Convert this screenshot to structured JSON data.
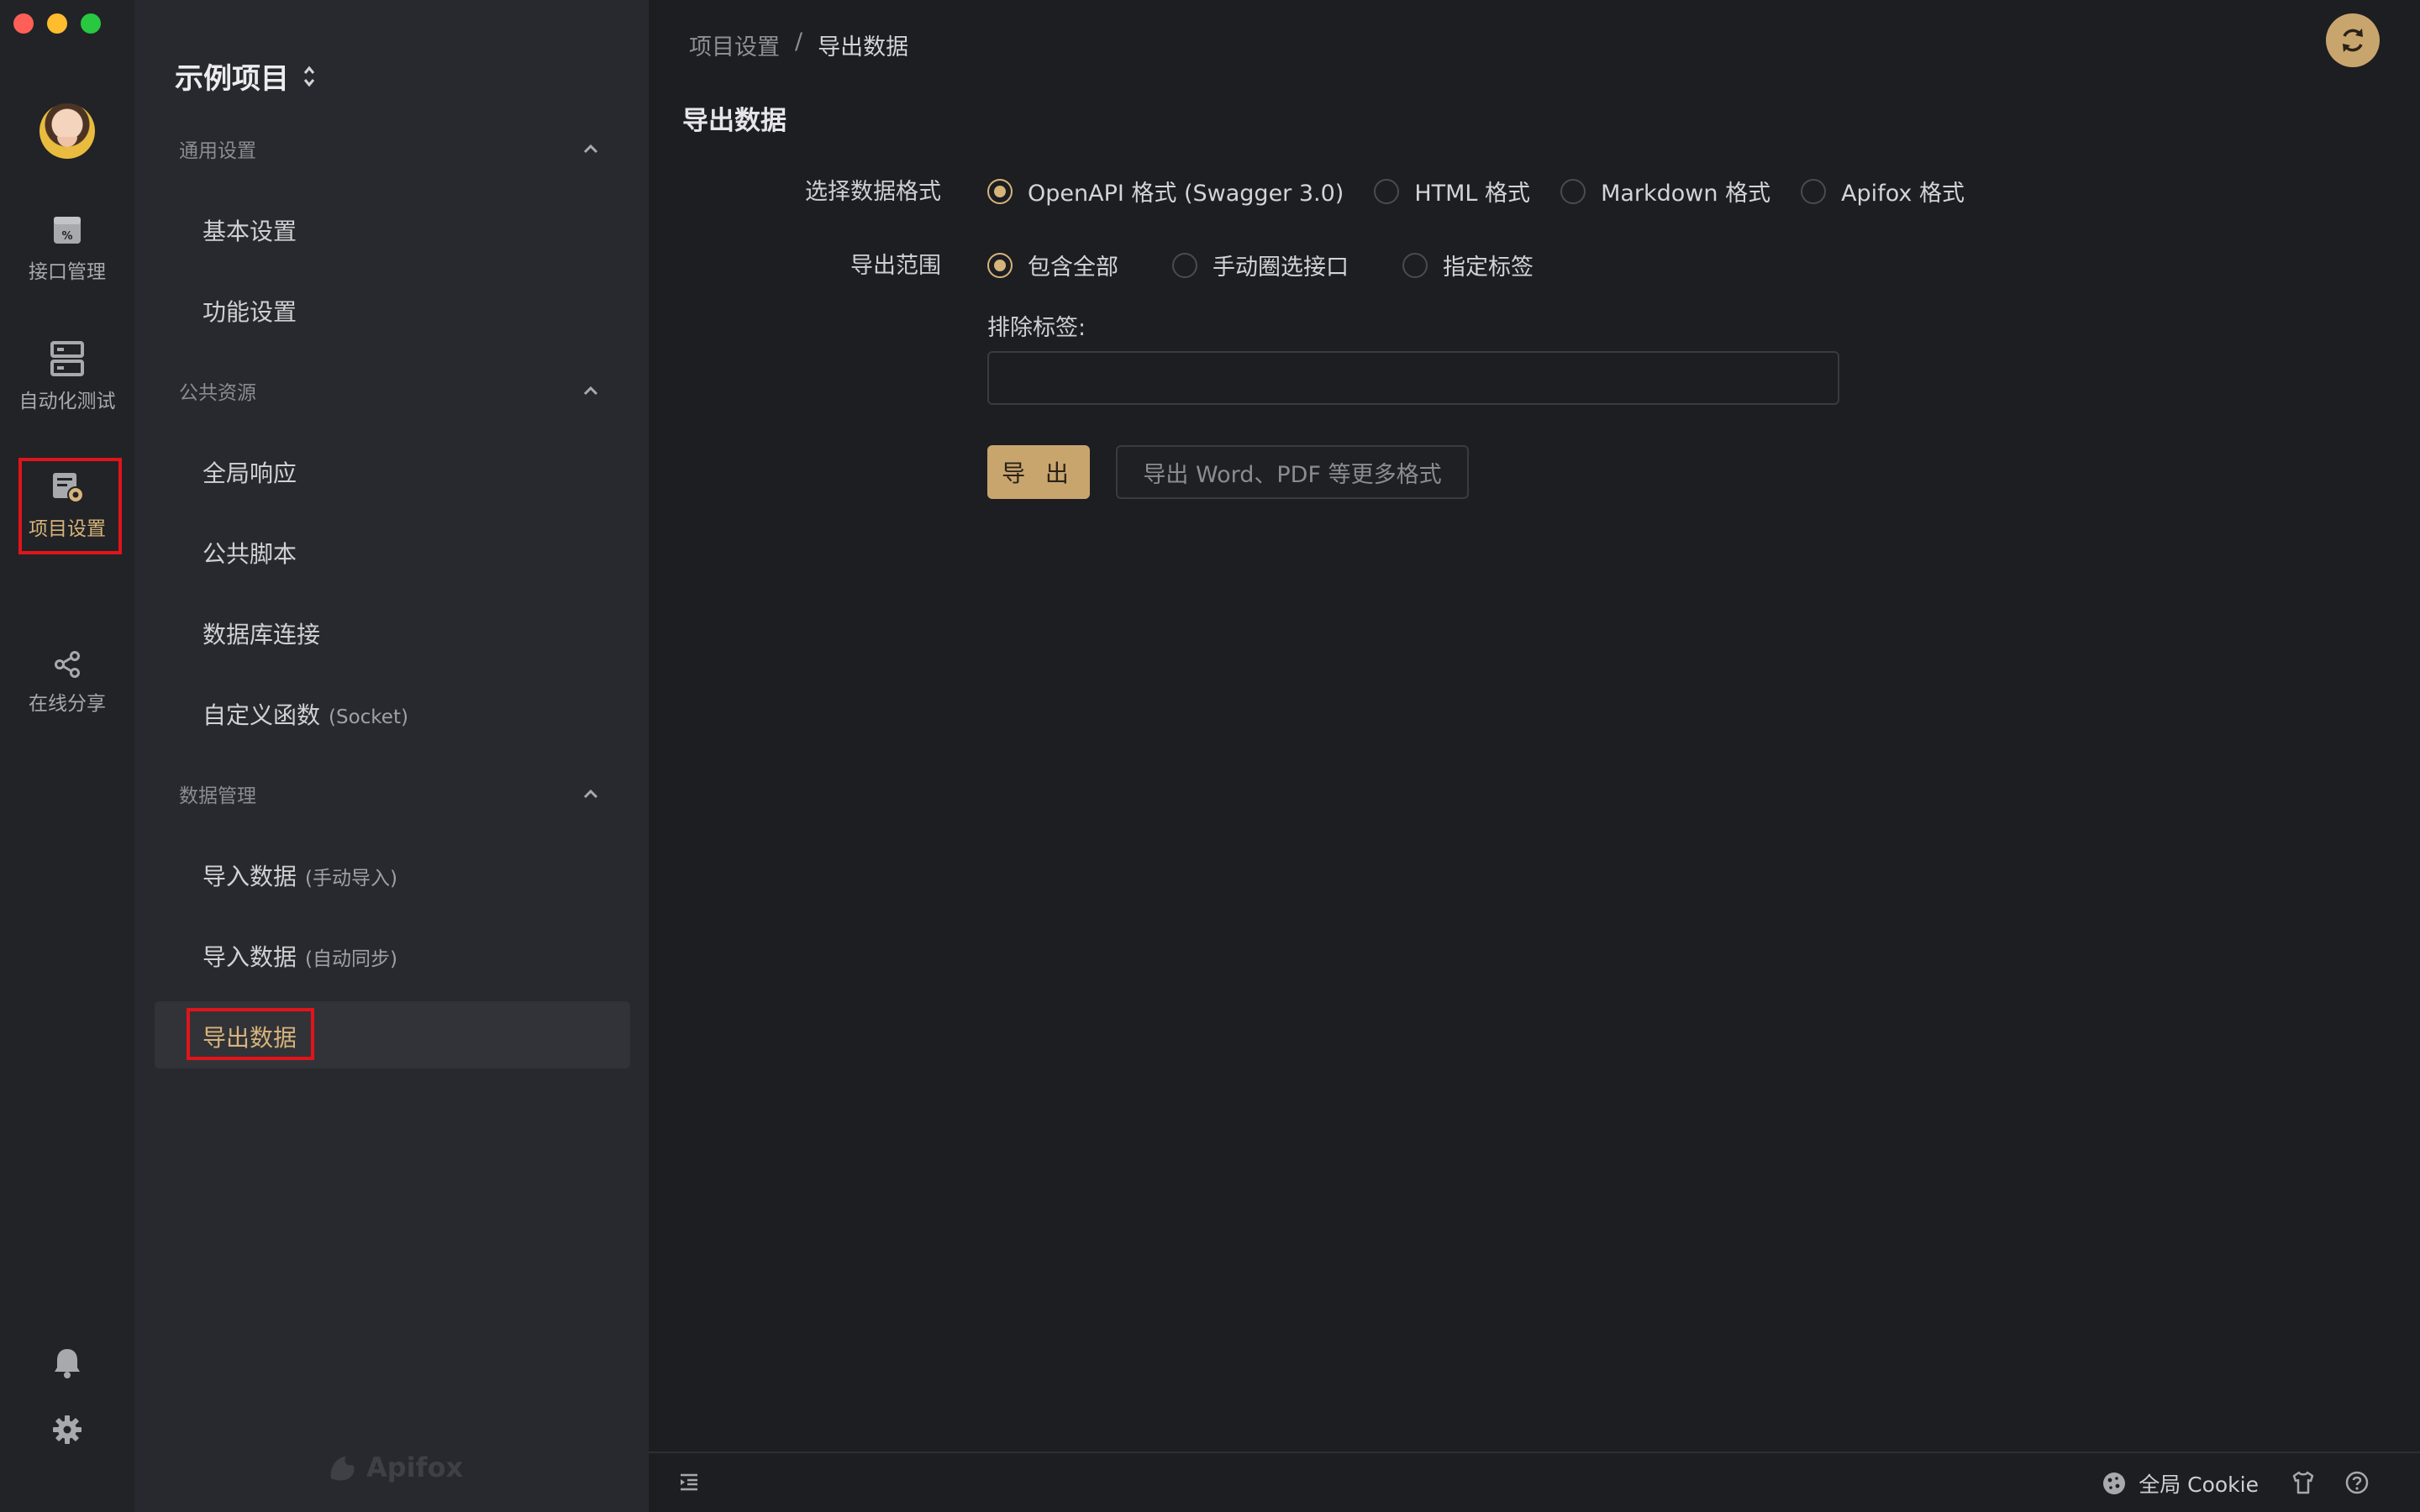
{
  "rail": {
    "items": [
      {
        "label": "接口管理",
        "icon": "api-icon"
      },
      {
        "label": "自动化测试",
        "icon": "server-icon"
      },
      {
        "label": "项目设置",
        "icon": "project-settings-icon",
        "active": true
      },
      {
        "label": "在线分享",
        "icon": "share-icon"
      }
    ]
  },
  "sidebar": {
    "project_name": "示例项目",
    "sections": [
      {
        "title": "通用设置",
        "items": [
          {
            "label": "基本设置",
            "sub": ""
          },
          {
            "label": "功能设置",
            "sub": ""
          }
        ]
      },
      {
        "title": "公共资源",
        "items": [
          {
            "label": "全局响应",
            "sub": ""
          },
          {
            "label": "公共脚本",
            "sub": ""
          },
          {
            "label": "数据库连接",
            "sub": ""
          },
          {
            "label": "自定义函数",
            "sub": "(Socket)"
          }
        ]
      },
      {
        "title": "数据管理",
        "items": [
          {
            "label": "导入数据",
            "sub": "(手动导入)"
          },
          {
            "label": "导入数据",
            "sub": "(自动同步)"
          },
          {
            "label": "导出数据",
            "sub": "",
            "active": true
          }
        ]
      }
    ],
    "brand": "Apifox"
  },
  "breadcrumb": {
    "parent": "项目设置",
    "separator": "/",
    "current": "导出数据"
  },
  "page": {
    "title": "导出数据",
    "format": {
      "label": "选择数据格式",
      "options": [
        "OpenAPI 格式 (Swagger 3.0)",
        "HTML 格式",
        "Markdown 格式",
        "Apifox 格式"
      ],
      "selected": "OpenAPI 格式 (Swagger 3.0)"
    },
    "scope": {
      "label": "导出范围",
      "options": [
        "包含全部",
        "手动圈选接口",
        "指定标签"
      ],
      "selected": "包含全部"
    },
    "exclude": {
      "label": "排除标签:",
      "value": ""
    },
    "export_btn": "导 出",
    "more_btn": "导出 Word、PDF 等更多格式"
  },
  "footer": {
    "cookie_label": "全局 Cookie"
  },
  "colors": {
    "accent": "#d6b47a",
    "accent_button": "#c9a56e",
    "highlight": "#e0141b",
    "bg": "#1d1e22",
    "sidebar": "#28292e",
    "rail": "#222327"
  }
}
